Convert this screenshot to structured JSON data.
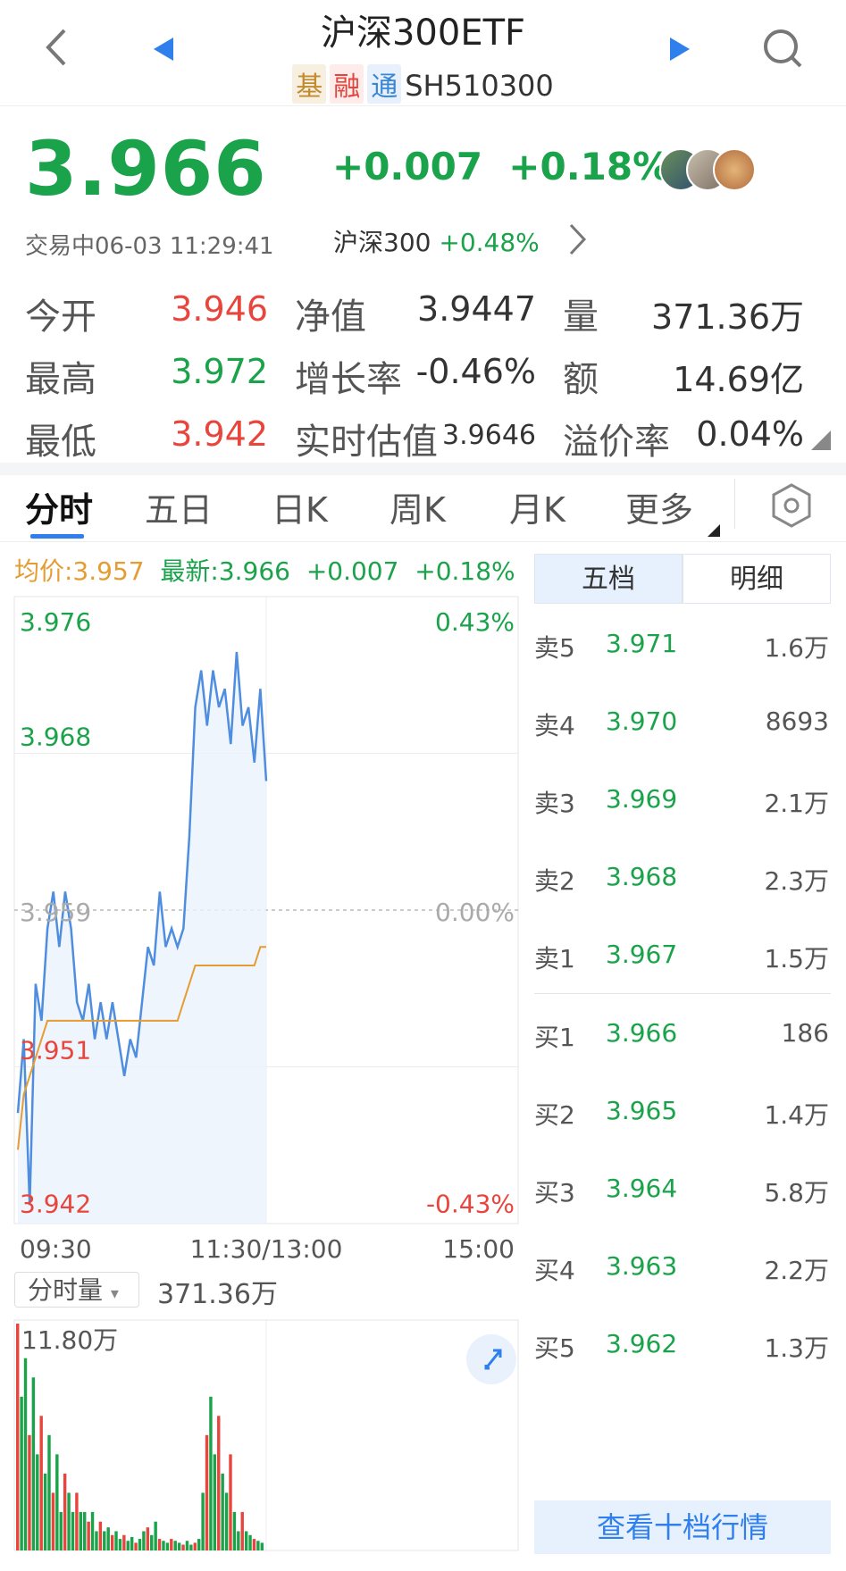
{
  "header": {
    "title": "沪深300ETF",
    "tags": [
      "基",
      "融",
      "通"
    ],
    "code": "SH510300"
  },
  "quote": {
    "price": "3.966",
    "change": "+0.007",
    "change_pct": "+0.18%",
    "status_time": "交易中06-03 11:29:41",
    "index_name": "沪深300",
    "index_change": "+0.48%"
  },
  "stats": [
    {
      "label": "今开",
      "value": "3.946",
      "color": "#e8453c"
    },
    {
      "label": "最高",
      "value": "3.972",
      "color": "#1aa34a"
    },
    {
      "label": "最低",
      "value": "3.942",
      "color": "#e8453c"
    },
    {
      "label": "净值",
      "value": "3.9447",
      "color": "#333333"
    },
    {
      "label": "增长率",
      "value": "-0.46%",
      "color": "#333333"
    },
    {
      "label": "实时估值",
      "value": "3.9646",
      "color": "#333333"
    },
    {
      "label": "量",
      "value": "371.36万",
      "color": "#333333"
    },
    {
      "label": "额",
      "value": "14.69亿",
      "color": "#333333"
    },
    {
      "label": "溢价率",
      "value": "0.04%",
      "color": "#333333"
    }
  ],
  "tabs": [
    "分时",
    "五日",
    "日K",
    "周K",
    "月K",
    "更多"
  ],
  "chart_header": {
    "avg": "均价:3.957",
    "latest": "最新:3.966",
    "change": "+0.007",
    "pct": "+0.18%"
  },
  "chart_data": {
    "type": "line",
    "y_left_ticks": [
      "3.976",
      "3.968",
      "3.959",
      "3.951",
      "3.942"
    ],
    "y_right_ticks": [
      "0.43%",
      "0.00%",
      "-0.43%"
    ],
    "x_ticks": [
      "09:30",
      "11:30/13:00",
      "15:00"
    ],
    "ylim": [
      3.942,
      3.976
    ],
    "base": 3.959,
    "series": [
      {
        "name": "最新",
        "color": "#4f8ddf",
        "values": [
          3.948,
          3.952,
          3.943,
          3.955,
          3.953,
          3.958,
          3.96,
          3.957,
          3.96,
          3.958,
          3.954,
          3.953,
          3.955,
          3.952,
          3.954,
          3.952,
          3.954,
          3.952,
          3.95,
          3.952,
          3.951,
          3.954,
          3.957,
          3.956,
          3.96,
          3.957,
          3.958,
          3.957,
          3.958,
          3.963,
          3.97,
          3.972,
          3.969,
          3.972,
          3.97,
          3.971,
          3.968,
          3.973,
          3.969,
          3.97,
          3.967,
          3.971,
          3.966
        ]
      },
      {
        "name": "均价",
        "color": "#e59c32",
        "values": [
          3.946,
          3.949,
          3.95,
          3.951,
          3.952,
          3.953,
          3.953,
          3.953,
          3.953,
          3.953,
          3.953,
          3.953,
          3.953,
          3.953,
          3.953,
          3.953,
          3.953,
          3.953,
          3.953,
          3.953,
          3.953,
          3.953,
          3.953,
          3.953,
          3.953,
          3.953,
          3.953,
          3.953,
          3.954,
          3.955,
          3.956,
          3.956,
          3.956,
          3.956,
          3.956,
          3.956,
          3.956,
          3.956,
          3.956,
          3.956,
          3.956,
          3.957,
          3.957
        ]
      }
    ]
  },
  "volume": {
    "selector": "分时量",
    "total": "371.36万",
    "max_label": "11.80万",
    "values": [
      11.8,
      8,
      10,
      6,
      9,
      5,
      7,
      4,
      6,
      3,
      5,
      2,
      4,
      3,
      2,
      3,
      2,
      2,
      1.5,
      2,
      1,
      1.5,
      1,
      1.2,
      0.8,
      1,
      0.6,
      0.8,
      0.5,
      0.7,
      0.4,
      0.6,
      1,
      1.2,
      0.8,
      1.5,
      0.6,
      0.5,
      0.4,
      0.6,
      0.5,
      0.4,
      0.3,
      0.5,
      0.3,
      0.4,
      0.6,
      3,
      6,
      8,
      5,
      7,
      4,
      3,
      5,
      2,
      1,
      2,
      1,
      0.8,
      0.6,
      0.5,
      0.4
    ],
    "up_color": "#e8453c",
    "down_color": "#1aa34a"
  },
  "order_book": {
    "tabs": [
      "五档",
      "明细"
    ],
    "sells": [
      {
        "label": "卖5",
        "price": "3.971",
        "vol": "1.6万"
      },
      {
        "label": "卖4",
        "price": "3.970",
        "vol": "8693"
      },
      {
        "label": "卖3",
        "price": "3.969",
        "vol": "2.1万"
      },
      {
        "label": "卖2",
        "price": "3.968",
        "vol": "2.3万"
      },
      {
        "label": "卖1",
        "price": "3.967",
        "vol": "1.5万"
      }
    ],
    "buys": [
      {
        "label": "买1",
        "price": "3.966",
        "vol": "186"
      },
      {
        "label": "买2",
        "price": "3.965",
        "vol": "1.4万"
      },
      {
        "label": "买3",
        "price": "3.964",
        "vol": "5.8万"
      },
      {
        "label": "买4",
        "price": "3.963",
        "vol": "2.2万"
      },
      {
        "label": "买5",
        "price": "3.962",
        "vol": "1.3万"
      }
    ],
    "more_button": "查看十档行情"
  },
  "icons": [
    "back-arrow-icon",
    "prev-triangle-icon",
    "next-triangle-icon",
    "search-icon",
    "chevron-right-icon",
    "settings-hex-icon",
    "expand-icon",
    "dropdown-caret-icon"
  ]
}
